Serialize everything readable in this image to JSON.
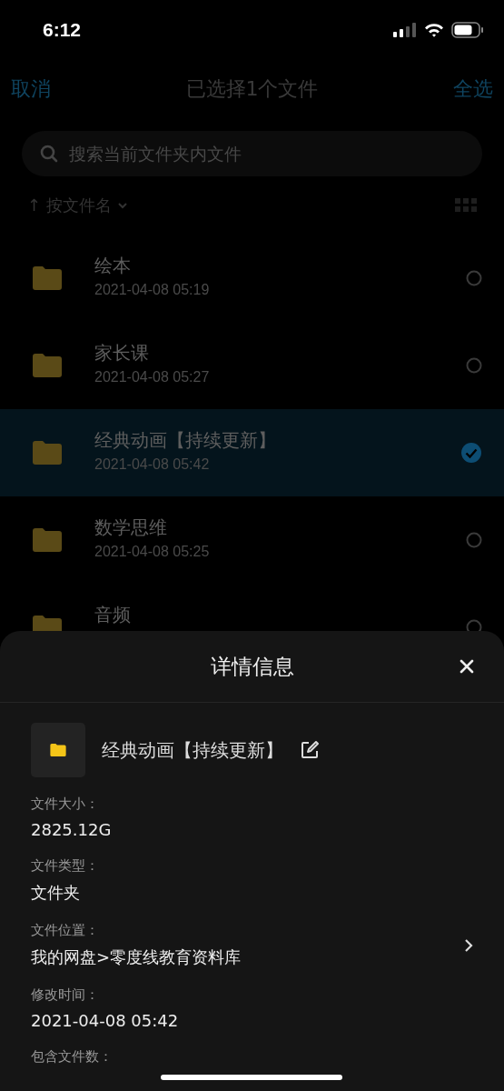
{
  "status_bar": {
    "time": "6:12"
  },
  "nav": {
    "cancel": "取消",
    "title": "已选择1个文件",
    "select_all": "全选"
  },
  "search": {
    "placeholder": "搜索当前文件夹内文件"
  },
  "sort": {
    "arrow": "↑",
    "label": "按文件名"
  },
  "files": [
    {
      "name": "绘本",
      "date": "2021-04-08 05:19",
      "selected": false
    },
    {
      "name": "家长课",
      "date": "2021-04-08 05:27",
      "selected": false
    },
    {
      "name": "经典动画【持续更新】",
      "date": "2021-04-08 05:42",
      "selected": true
    },
    {
      "name": "数学思维",
      "date": "2021-04-08 05:25",
      "selected": false
    },
    {
      "name": "音频",
      "selected": false
    }
  ],
  "details": {
    "title": "详情信息",
    "file_name": "经典动画【持续更新】",
    "fields": [
      {
        "label": "文件大小：",
        "value": "2825.12G",
        "kind": "plain"
      },
      {
        "label": "文件类型：",
        "value": "文件夹",
        "kind": "plain"
      },
      {
        "label": "文件位置：",
        "value": "我的网盘>零度线教育资料库",
        "kind": "link"
      },
      {
        "label": "修改时间：",
        "value": "2021-04-08 05:42",
        "kind": "plain"
      },
      {
        "label": "包含文件数：",
        "kind": "plain"
      }
    ]
  }
}
